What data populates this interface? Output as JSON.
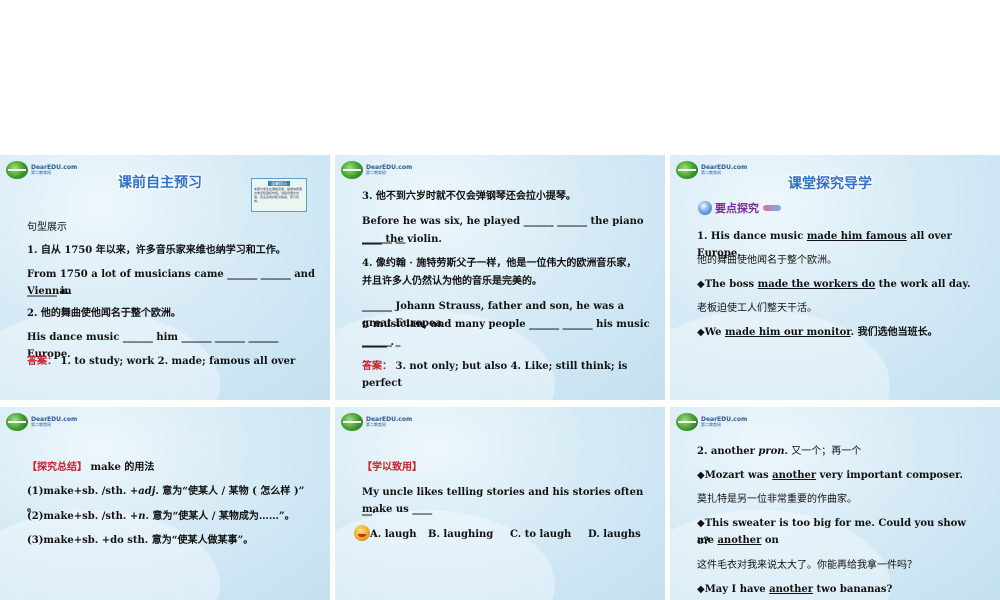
{
  "logo": {
    "main": "DearEDU.com",
    "sub": "第二教育网"
  },
  "slides": [
    {
      "title": "课前自主预习",
      "note": {
        "header": "温馨提示",
        "text": "本部分学生在课前完成，提前熟悉课文重点短语和句型。请结合课文内容，自主完成并核对答案，预习有效。"
      },
      "lines": [
        "句型展示",
        "1.  自从 1750 年以来，许多音乐家来维也纳学习和工作。",
        "From 1750 a lot of musicians came ______ ______ and ______ in",
        "Vienna.",
        "2.  他的舞曲使他闻名于整个欧洲。",
        "His dance music ______ him ______ ______ ______ Europe."
      ],
      "answer_label": "答案：",
      "answer_text": "1. to study; work          2. made; famous all over"
    },
    {
      "lines": [
        "3.  他不到六岁时就不仅会弹钢琴还会拉小提琴。",
        "Before he was six, he played ______ ______ the piano ______ __",
        "____ the violin.",
        "4.  像约翰 · 施特劳斯父子一样，他是一位伟大的欧洲音乐家，",
        "并且许多人仍然认为他的音乐是完美的。",
        "______ Johann Strauss, father and son, he was a great Europea",
        "n musician, and many people ______ ______ his music  ______ _",
        "_____ ."
      ],
      "answer_label": "答案：",
      "answer_text": "3. not only; but also          4. Like; still think; is perfect"
    },
    {
      "title": "课堂探究导学",
      "subhead": "要点探究",
      "line1": {
        "pre": "1. His dance music ",
        "u": "made him famous",
        "post": " all over Europe."
      },
      "line2": "他的舞曲使他闻名于整个欧洲。",
      "line3": {
        "pre": "◆The boss ",
        "u": "made the workers do",
        "post": " the work all day."
      },
      "line4": "老板迫使工人们整天干活。",
      "line5": {
        "pre": "◆We ",
        "u": "made him our monitor",
        "post": ".  我们选他当班长。"
      }
    },
    {
      "bracket": "【探究总结】",
      "bracket_tail": " make 的用法",
      "rules": [
        {
          "head": "(1)make+sb. /sth. +",
          "em": "adj.",
          "tail": " 意为“使某人 / 某物 ( 怎么样 )” 。"
        },
        {
          "head": "(2)make+sb. /sth. +",
          "em": "n.",
          "tail": " 意为“使某人 / 某物成为……”。"
        },
        {
          "head": "(3)make+sb. +do sth.",
          "em": "",
          "tail": " 意为“使某人做某事”。"
        }
      ]
    },
    {
      "bracket": "【学以致用】",
      "question": "My uncle likes telling stories and his stories often make us ____",
      "question2": "__.",
      "options": [
        "A. laugh",
        "B. laughing",
        "C. to laugh",
        "D. laughs"
      ]
    },
    {
      "line1": {
        "head": "2. another ",
        "em": "pron.",
        "tail": "  又一个；再一个"
      },
      "line2": {
        "pre": "◆Mozart was ",
        "u": "another",
        "post": " very important composer."
      },
      "line3": "莫扎特是另一位非常重要的作曲家。",
      "line4": {
        "pre": "◆This sweater is too big for me. Could you show me ",
        "u": "another",
        "post": " on"
      },
      "line5": "e?",
      "line6": "这件毛衣对我来说太大了。你能再给我拿一件吗？",
      "line7": {
        "pre": "◆May I have ",
        "u": "another",
        "post": " two bananas?"
      }
    }
  ]
}
